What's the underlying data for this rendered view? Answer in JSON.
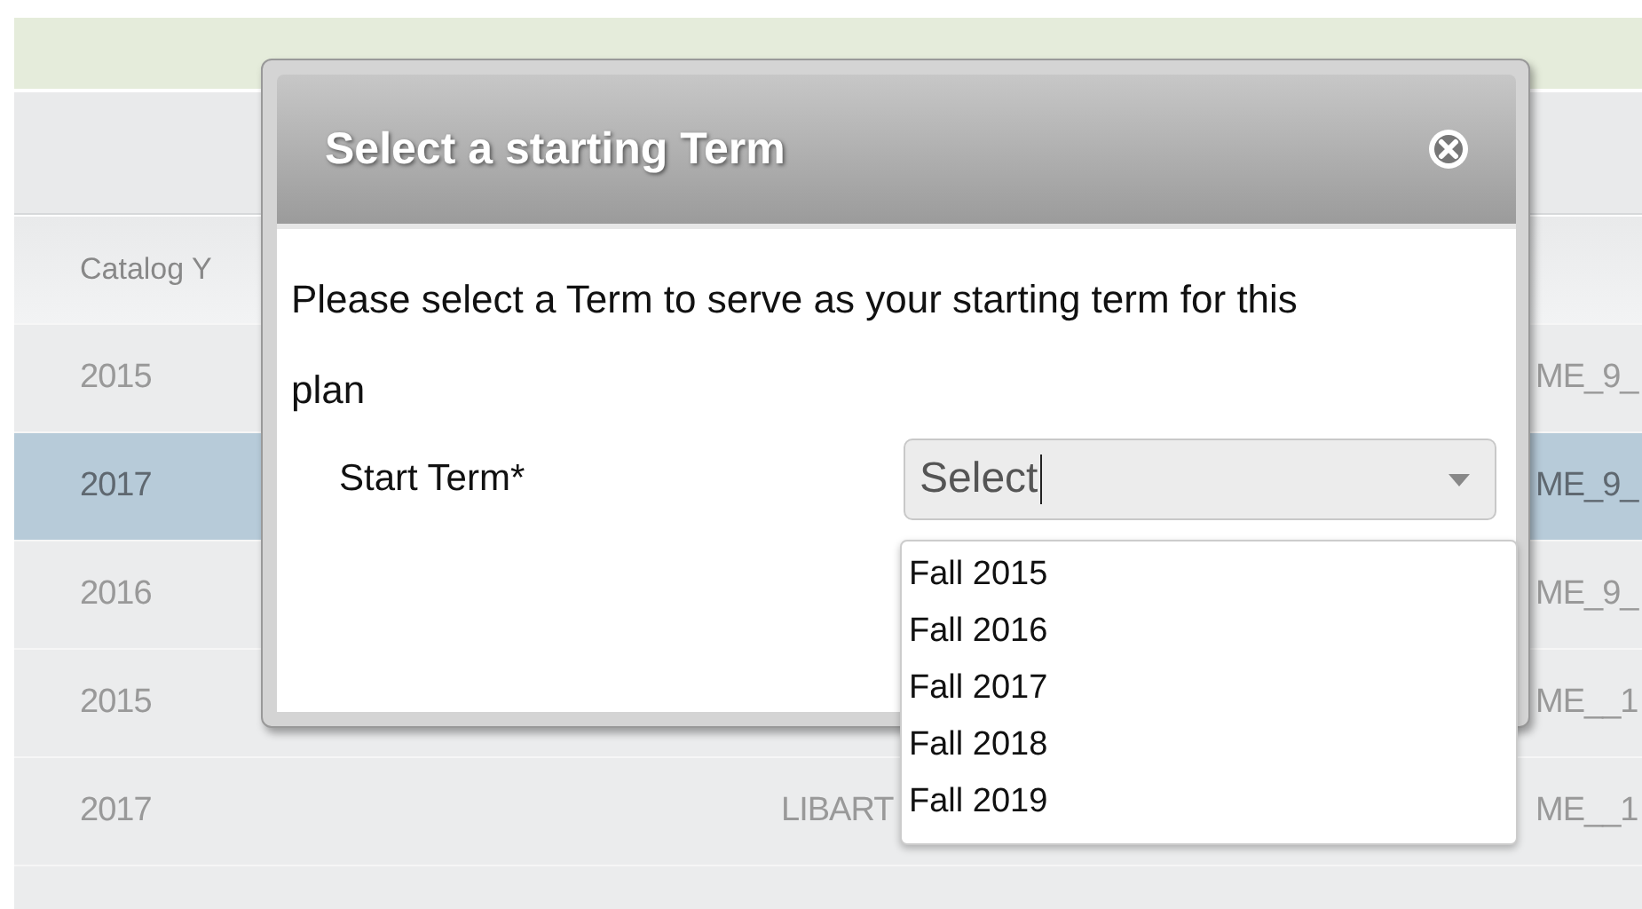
{
  "table": {
    "columns": [
      "Catalog Y"
    ],
    "rows": [
      {
        "column_1": "2015",
        "column_3": "ME_9_",
        "selected": false
      },
      {
        "column_1": "2017",
        "column_3": "ME_9_",
        "selected": true
      },
      {
        "column_1": "2016",
        "column_3": "ME_9_",
        "selected": false
      },
      {
        "column_1": "2015",
        "column_3": "ME__1",
        "selected": false
      },
      {
        "column_1": "2017",
        "column_2": "LIBART",
        "column_3": "ME__1",
        "selected": false
      }
    ]
  },
  "dialog": {
    "title": "Select a starting Term",
    "message": "Please select a Term to serve as your starting term for this plan",
    "field_label": "Start Term*",
    "select": {
      "value": "Select",
      "expanded": true,
      "options": [
        "Fall 2015",
        "Fall 2016",
        "Fall 2017",
        "Fall 2018",
        "Fall 2019"
      ]
    }
  }
}
